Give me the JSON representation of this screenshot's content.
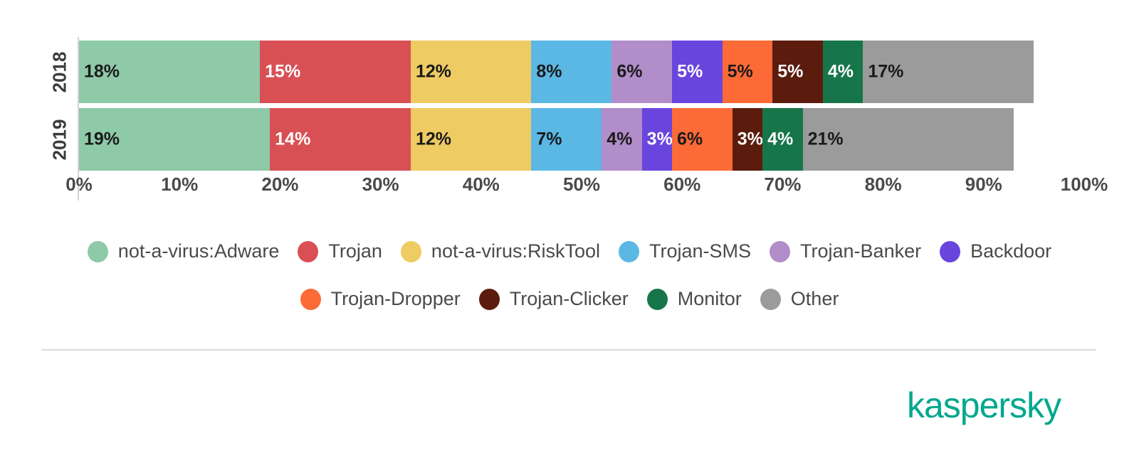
{
  "chart_data": {
    "type": "bar",
    "subtype": "stacked-horizontal-100",
    "title": "",
    "subtitle": "",
    "xlabel": "",
    "ylabel": "",
    "orientation": "horizontal",
    "stacked": true,
    "normalized": true,
    "grid": false,
    "legend_position": "bottom",
    "xlim": [
      0,
      100
    ],
    "categories": [
      "2018",
      "2019"
    ],
    "x_ticks": [
      "0%",
      "10%",
      "20%",
      "30%",
      "40%",
      "50%",
      "60%",
      "70%",
      "80%",
      "90%",
      "100%"
    ],
    "x_tick_values": [
      0,
      10,
      20,
      30,
      40,
      50,
      60,
      70,
      80,
      90,
      100
    ],
    "series": [
      {
        "name": "not-a-virus:Adware",
        "color": "#8ec9a8",
        "values": [
          18,
          19
        ],
        "labels": [
          "18%",
          "19%"
        ],
        "label_color": "#1a1a1a"
      },
      {
        "name": "Trojan",
        "color": "#d95054",
        "values": [
          15,
          14
        ],
        "labels": [
          "15%",
          "14%"
        ],
        "label_color": "#ffffff"
      },
      {
        "name": "not-a-virus:RiskTool",
        "color": "#eecb63",
        "values": [
          12,
          12
        ],
        "labels": [
          "12%",
          "12%"
        ],
        "label_color": "#1a1a1a"
      },
      {
        "name": "Trojan-SMS",
        "color": "#5bb8e5",
        "values": [
          8,
          7
        ],
        "labels": [
          "8%",
          "7%"
        ],
        "label_color": "#1a1a1a"
      },
      {
        "name": "Trojan-Banker",
        "color": "#b18dc9",
        "values": [
          6,
          4
        ],
        "labels": [
          "6%",
          "4%"
        ],
        "label_color": "#1a1a1a"
      },
      {
        "name": "Backdoor",
        "color": "#6a45dd",
        "values": [
          5,
          3
        ],
        "labels": [
          "5%",
          "3%"
        ],
        "label_color": "#ffffff"
      },
      {
        "name": "Trojan-Dropper",
        "color": "#fb6a37",
        "values": [
          5,
          6
        ],
        "labels": [
          "5%",
          "6%"
        ],
        "label_color": "#1a1a1a"
      },
      {
        "name": "Trojan-Clicker",
        "color": "#5b1c0e",
        "values": [
          5,
          3
        ],
        "labels": [
          "5%",
          "3%"
        ],
        "label_color": "#ffffff"
      },
      {
        "name": "Monitor",
        "color": "#17754a",
        "values": [
          4,
          4
        ],
        "labels": [
          "4%",
          "4%"
        ],
        "label_color": "#ffffff"
      },
      {
        "name": "Other",
        "color": "#9b9b9b",
        "values": [
          17,
          21
        ],
        "labels": [
          "17%",
          "21%"
        ],
        "label_color": "#1a1a1a"
      }
    ]
  },
  "legend": {
    "rows": [
      [
        "not-a-virus:Adware",
        "Trojan",
        "not-a-virus:RiskTool",
        "Trojan-SMS",
        "Trojan-Banker",
        "Backdoor"
      ],
      [
        "Trojan-Dropper",
        "Trojan-Clicker",
        "Monitor",
        "Other"
      ]
    ]
  },
  "brand": {
    "name": "kaspersky",
    "color": "#00a88e"
  }
}
